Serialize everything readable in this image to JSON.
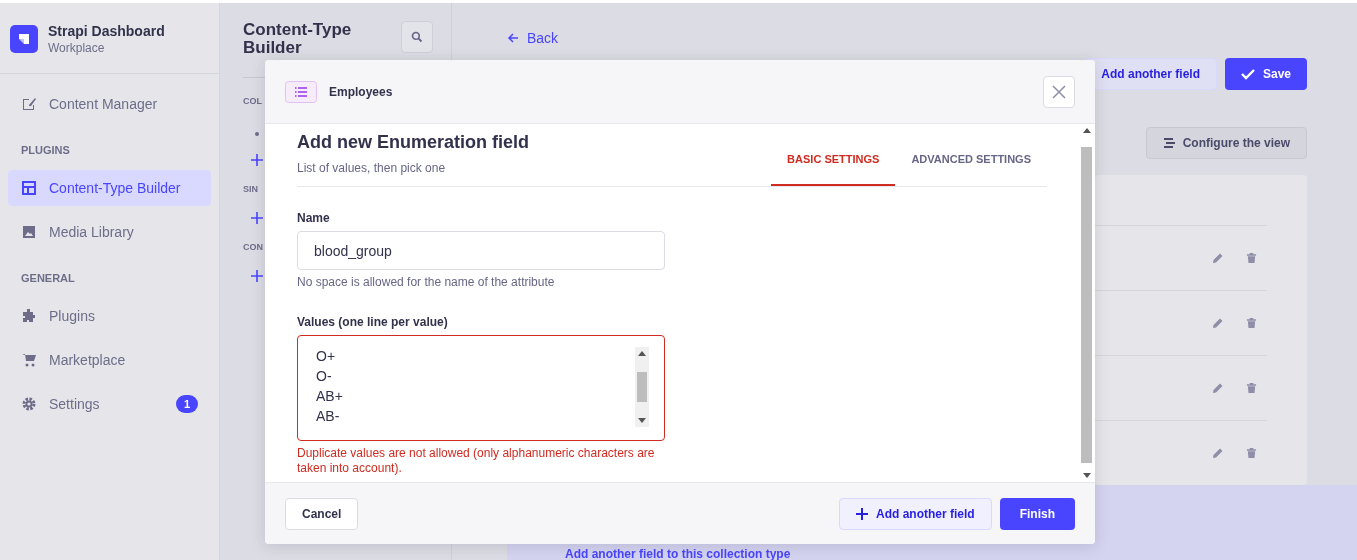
{
  "brand": {
    "title": "Strapi Dashboard",
    "subtitle": "Workplace"
  },
  "sidebar": [
    {
      "kind": "item",
      "label": "Content Manager",
      "selected": false
    },
    {
      "kind": "section",
      "label": "PLUGINS"
    },
    {
      "kind": "item",
      "label": "Content-Type Builder",
      "selected": true
    },
    {
      "kind": "item",
      "label": "Media Library",
      "selected": false
    },
    {
      "kind": "section",
      "label": "GENERAL"
    },
    {
      "kind": "item",
      "label": "Plugins",
      "selected": false
    },
    {
      "kind": "item",
      "label": "Marketplace",
      "selected": false
    },
    {
      "kind": "item",
      "label": "Settings",
      "selected": false,
      "badge": "1"
    }
  ],
  "builder_panel": {
    "title": "Content-Type Builder",
    "sections": [
      "COL",
      "SIN",
      "CON"
    ]
  },
  "main": {
    "back": "Back",
    "add_field": "Add another field",
    "save": "Save",
    "configure": "Configure the view",
    "footer_link": "Add another field to this collection type"
  },
  "modal": {
    "content_type": "Employees",
    "title": "Add new Enumeration field",
    "subtitle": "List of values, then pick one",
    "tabs": [
      {
        "label": "BASIC SETTINGS",
        "selected": true
      },
      {
        "label": "ADVANCED SETTINGS",
        "selected": false
      }
    ],
    "name": {
      "label": "Name",
      "value": "blood_group",
      "hint": "No space is allowed for the name of the attribute"
    },
    "values": {
      "label": "Values (one line per value)",
      "lines": [
        "O+",
        "O-",
        "AB+",
        "AB-"
      ],
      "error": "Duplicate values are not allowed (only alphanumeric characters are taken into account)."
    },
    "cancel": "Cancel",
    "add_field": "Add another field",
    "finish": "Finish"
  }
}
